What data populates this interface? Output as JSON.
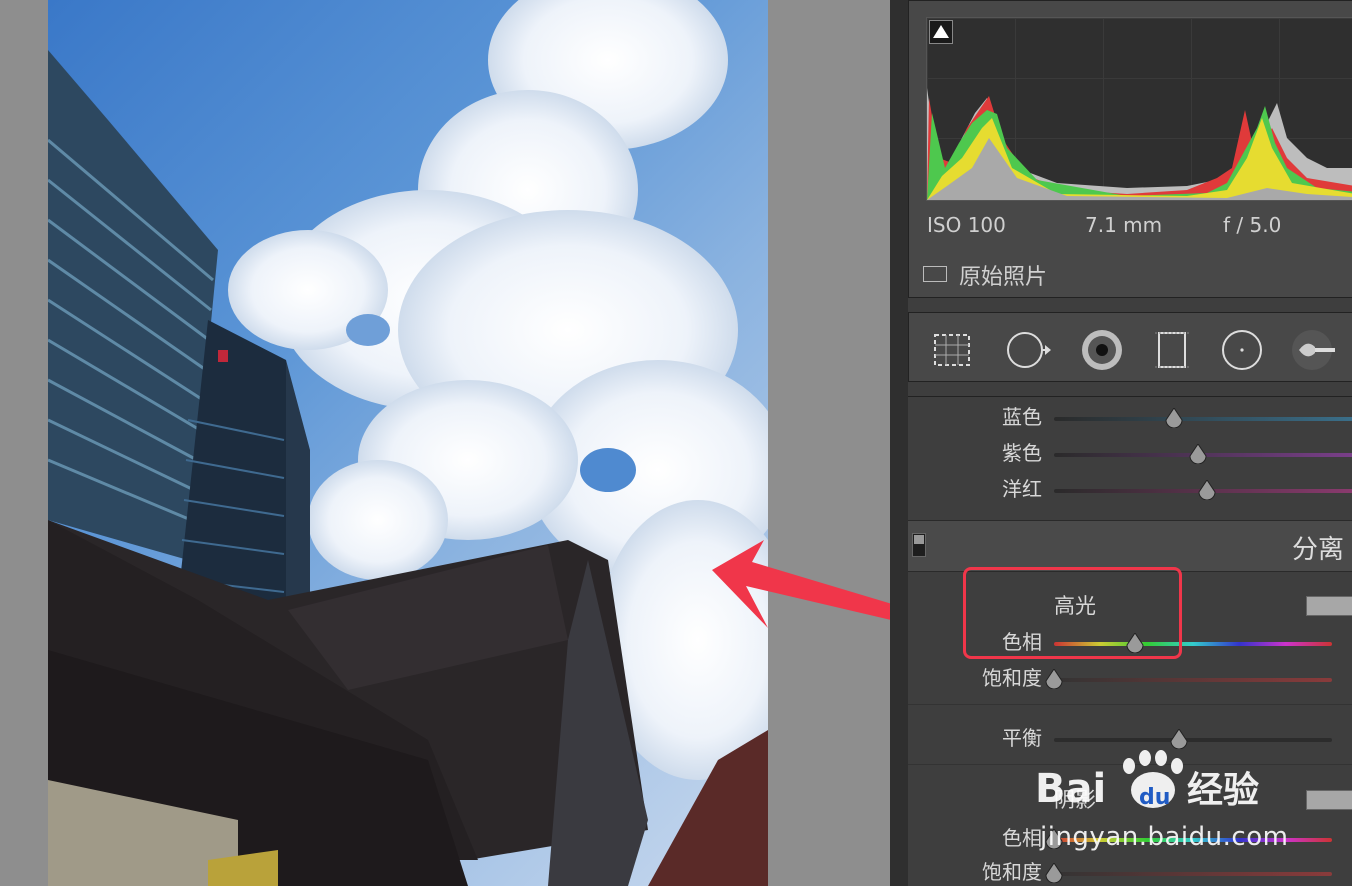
{
  "histogram": {
    "exif": {
      "iso": "ISO 100",
      "focal": "7.1 mm",
      "aperture": "f / 5.0"
    },
    "original_photo_label": "原始照片"
  },
  "tools": [
    "crop-overlay-icon",
    "spot-removal-icon",
    "red-eye-icon",
    "graduated-filter-icon",
    "radial-filter-icon",
    "adjustment-brush-icon"
  ],
  "hsl": {
    "rows": [
      {
        "label": "蓝色",
        "value": 0.4
      },
      {
        "label": "紫色",
        "value": 0.48
      },
      {
        "label": "洋红",
        "value": 0.51
      }
    ]
  },
  "split_toning": {
    "header": "分离",
    "highlights": {
      "title": "高光",
      "hue_label": "色相",
      "hue_value": 0.29,
      "saturation_label": "饱和度",
      "saturation_value": 0.0
    },
    "balance": {
      "label": "平衡",
      "value": 0.45
    },
    "shadows": {
      "title": "阴影",
      "hue_label": "色相",
      "hue_value": 0.0,
      "saturation_label": "饱和度",
      "saturation_value": 0.0
    }
  },
  "watermark": {
    "brand": "Bai du 经验",
    "url": "jingyan.baidu.com"
  },
  "colors": {
    "annotation_red": "#f0364a",
    "panel_bg": "#3e3e3e"
  }
}
